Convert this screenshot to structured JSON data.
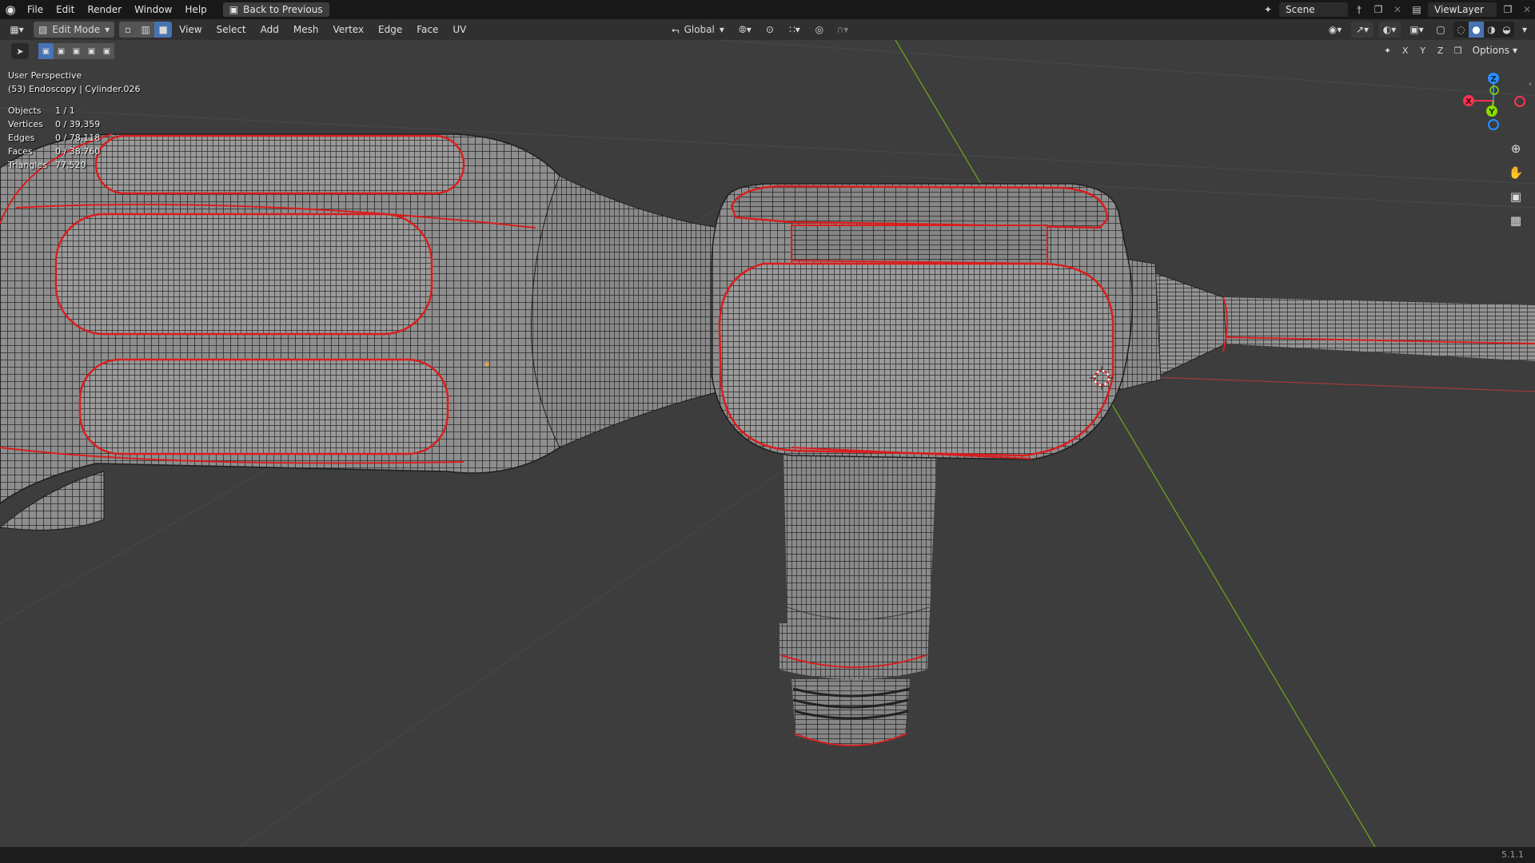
{
  "menu": {
    "items": [
      "File",
      "Edit",
      "Render",
      "Window",
      "Help"
    ],
    "back_button": "Back to Previous"
  },
  "top_right": {
    "scene_label": "Scene",
    "viewlayer_label": "ViewLayer"
  },
  "header": {
    "mode_label": "Edit Mode",
    "menus": [
      "View",
      "Select",
      "Add",
      "Mesh",
      "Vertex",
      "Edge",
      "Face",
      "UV"
    ],
    "orientation_label": "Global"
  },
  "toolbar_right": {
    "axis_x": "X",
    "axis_y": "Y",
    "axis_z": "Z",
    "options_label": "Options"
  },
  "overlay": {
    "view_name": "User Perspective",
    "object_info": "(53) Endoscopy | Cylinder.026"
  },
  "stats": [
    {
      "label": "Objects",
      "value": "1 / 1"
    },
    {
      "label": "Vertices",
      "value": "0 / 39,359"
    },
    {
      "label": "Edges",
      "value": "0 / 78,118"
    },
    {
      "label": "Faces",
      "value": "0 / 38,760"
    },
    {
      "label": "Triangles",
      "value": "77,520"
    }
  ],
  "gizmo": {
    "x_label": "X",
    "y_label": "Y",
    "z_label": "Z",
    "x_color": "#ff3352",
    "y_color": "#8bdc00",
    "z_color": "#2890ff"
  },
  "status": {
    "version": "5.1.1"
  },
  "colors": {
    "viewport_bg": "#3d3d3d",
    "mesh_fill": "#8e8e8e",
    "seam_red": "#d81e1e",
    "active_blue": "#4772b3"
  }
}
